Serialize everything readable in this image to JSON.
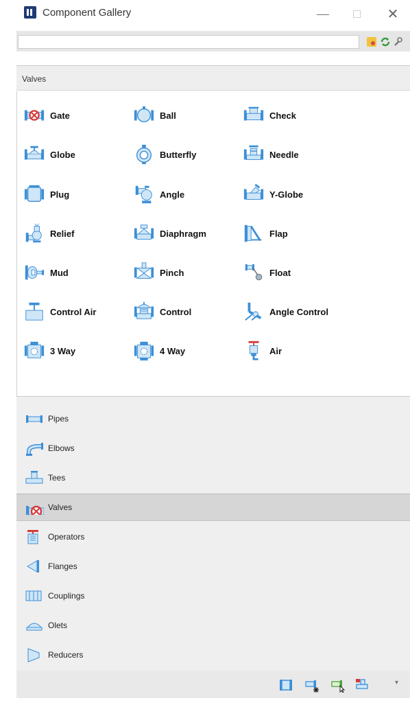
{
  "window": {
    "title": "Component Gallery"
  },
  "search": {
    "value": "",
    "placeholder": ""
  },
  "section": {
    "title": "Valves"
  },
  "valves": [
    {
      "label": "Gate",
      "icon": "gate-valve-icon"
    },
    {
      "label": "Ball",
      "icon": "ball-valve-icon"
    },
    {
      "label": "Check",
      "icon": "check-valve-icon"
    },
    {
      "label": "Globe",
      "icon": "globe-valve-icon"
    },
    {
      "label": "Butterfly",
      "icon": "butterfly-valve-icon"
    },
    {
      "label": "Needle",
      "icon": "needle-valve-icon"
    },
    {
      "label": "Plug",
      "icon": "plug-valve-icon"
    },
    {
      "label": "Angle",
      "icon": "angle-valve-icon"
    },
    {
      "label": "Y-Globe",
      "icon": "y-globe-valve-icon"
    },
    {
      "label": "Relief",
      "icon": "relief-valve-icon"
    },
    {
      "label": "Diaphragm",
      "icon": "diaphragm-valve-icon"
    },
    {
      "label": "Flap",
      "icon": "flap-valve-icon"
    },
    {
      "label": "Mud",
      "icon": "mud-valve-icon"
    },
    {
      "label": "Pinch",
      "icon": "pinch-valve-icon"
    },
    {
      "label": "Float",
      "icon": "float-valve-icon"
    },
    {
      "label": "Control Air",
      "icon": "control-air-valve-icon"
    },
    {
      "label": "Control",
      "icon": "control-valve-icon"
    },
    {
      "label": "Angle Control",
      "icon": "angle-control-valve-icon"
    },
    {
      "label": "3 Way",
      "icon": "3-way-valve-icon"
    },
    {
      "label": "4 Way",
      "icon": "4-way-valve-icon"
    },
    {
      "label": "Air",
      "icon": "air-valve-icon"
    }
  ],
  "categories": [
    {
      "label": "Pipes",
      "icon": "pipe-icon",
      "active": false
    },
    {
      "label": "Elbows",
      "icon": "elbow-icon",
      "active": false
    },
    {
      "label": "Tees",
      "icon": "tee-icon",
      "active": false
    },
    {
      "label": "Valves",
      "icon": "gate-valve-icon",
      "active": true
    },
    {
      "label": "Operators",
      "icon": "operator-icon",
      "active": false
    },
    {
      "label": "Flanges",
      "icon": "flange-icon",
      "active": false
    },
    {
      "label": "Couplings",
      "icon": "coupling-icon",
      "active": false
    },
    {
      "label": "Olets",
      "icon": "olet-icon",
      "active": false
    },
    {
      "label": "Reducers",
      "icon": "reducer-icon",
      "active": false
    }
  ],
  "colors": {
    "icon_blue": "#3d8fd6",
    "icon_fill": "#cfe6f7",
    "icon_red": "#d43a3a",
    "active_row": "#d6d6d6",
    "header_bg": "#eeeeee"
  }
}
